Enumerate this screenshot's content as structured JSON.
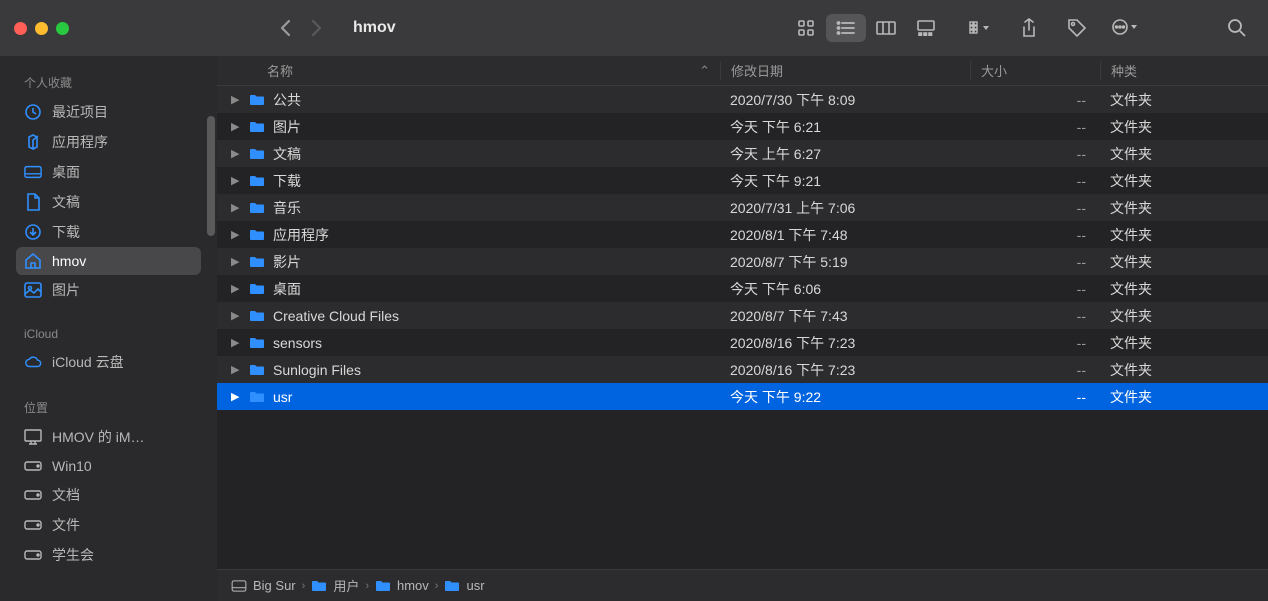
{
  "title": "hmov",
  "sidebar": {
    "sections": [
      {
        "header": "个人收藏",
        "items": [
          {
            "icon": "clock",
            "label": "最近项目"
          },
          {
            "icon": "apps",
            "label": "应用程序"
          },
          {
            "icon": "desktop",
            "label": "桌面"
          },
          {
            "icon": "document",
            "label": "文稿"
          },
          {
            "icon": "download",
            "label": "下载"
          },
          {
            "icon": "home",
            "label": "hmov",
            "selected": true
          },
          {
            "icon": "photo",
            "label": "图片"
          }
        ]
      },
      {
        "header": "iCloud",
        "items": [
          {
            "icon": "cloud",
            "label": "iCloud 云盘"
          }
        ]
      },
      {
        "header": "位置",
        "items": [
          {
            "icon": "imac",
            "label": "HMOV 的 iM…",
            "gray": true
          },
          {
            "icon": "disk",
            "label": "Win10",
            "gray": true
          },
          {
            "icon": "disk",
            "label": "文档",
            "gray": true
          },
          {
            "icon": "disk",
            "label": "文件",
            "gray": true
          },
          {
            "icon": "disk",
            "label": "学生会",
            "gray": true
          }
        ]
      }
    ]
  },
  "columns": {
    "name": "名称",
    "date": "修改日期",
    "size": "大小",
    "kind": "种类"
  },
  "files": [
    {
      "name": "公共",
      "date": "2020/7/30 下午 8:09",
      "size": "--",
      "kind": "文件夹"
    },
    {
      "name": "图片",
      "date": "今天 下午 6:21",
      "size": "--",
      "kind": "文件夹"
    },
    {
      "name": "文稿",
      "date": "今天 上午 6:27",
      "size": "--",
      "kind": "文件夹"
    },
    {
      "name": "下载",
      "date": "今天 下午 9:21",
      "size": "--",
      "kind": "文件夹"
    },
    {
      "name": "音乐",
      "date": "2020/7/31 上午 7:06",
      "size": "--",
      "kind": "文件夹"
    },
    {
      "name": "应用程序",
      "date": "2020/8/1 下午 7:48",
      "size": "--",
      "kind": "文件夹"
    },
    {
      "name": "影片",
      "date": "2020/8/7 下午 5:19",
      "size": "--",
      "kind": "文件夹"
    },
    {
      "name": "桌面",
      "date": "今天 下午 6:06",
      "size": "--",
      "kind": "文件夹"
    },
    {
      "name": "Creative Cloud Files",
      "date": "2020/8/7 下午 7:43",
      "size": "--",
      "kind": "文件夹"
    },
    {
      "name": "sensors",
      "date": "2020/8/16 下午 7:23",
      "size": "--",
      "kind": "文件夹"
    },
    {
      "name": "Sunlogin Files",
      "date": "2020/8/16 下午 7:23",
      "size": "--",
      "kind": "文件夹"
    },
    {
      "name": "usr",
      "date": "今天 下午 9:22",
      "size": "--",
      "kind": "文件夹",
      "selected": true
    }
  ],
  "pathbar": [
    {
      "icon": "disk",
      "label": "Big Sur"
    },
    {
      "icon": "folder",
      "label": "用户"
    },
    {
      "icon": "folder",
      "label": "hmov"
    },
    {
      "icon": "folder",
      "label": "usr"
    }
  ]
}
